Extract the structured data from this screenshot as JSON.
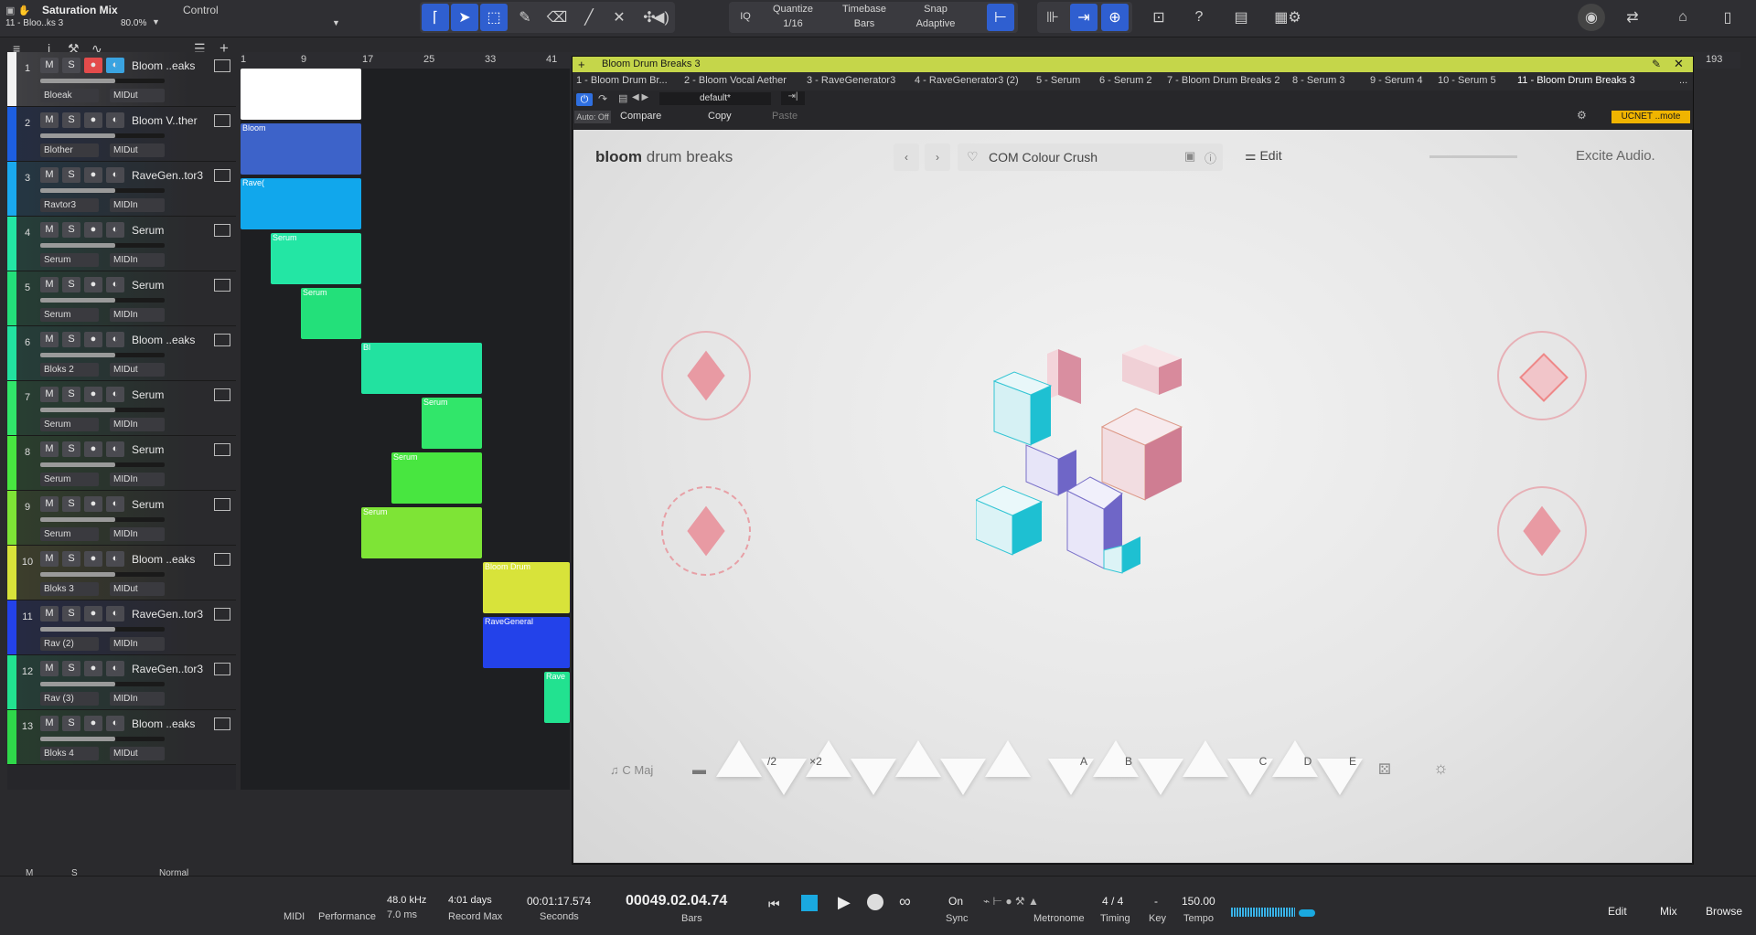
{
  "app": {
    "song_title": "Saturation Mix",
    "selected_track": "11 - Bloo..ks 3",
    "zoom": "80.0%",
    "control_label": "Control"
  },
  "toolbar": {
    "iq": "IQ",
    "quantize_label": "Quantize",
    "quantize_value": "1/16",
    "timebase_label": "Timebase",
    "timebase_value": "Bars",
    "snap_label": "Snap",
    "snap_value": "Adaptive"
  },
  "ruler": {
    "ticks": [
      "1",
      "9",
      "17",
      "25",
      "33",
      "41",
      "",
      "",
      "",
      "",
      "",
      "",
      "",
      "",
      "",
      "",
      "",
      "",
      "",
      "",
      "193"
    ]
  },
  "tracks": [
    {
      "num": "1",
      "name": "Bloom ..eaks",
      "insert": "Bloeak",
      "input": "MIDut",
      "color": "#f2f2f2",
      "rec": true
    },
    {
      "num": "2",
      "name": "Bloom V..ther",
      "insert": "Blother",
      "input": "MIDut",
      "color": "#1d5fe0",
      "rec": false
    },
    {
      "num": "3",
      "name": "RaveGen..tor3",
      "insert": "Ravtor3",
      "input": "MIDIn",
      "color": "#1aa8ee",
      "rec": false
    },
    {
      "num": "4",
      "name": "Serum",
      "insert": "Serum",
      "input": "MIDIn",
      "color": "#23e6a4",
      "rec": false
    },
    {
      "num": "5",
      "name": "Serum",
      "insert": "Serum",
      "input": "MIDIn",
      "color": "#23e07a",
      "rec": false
    },
    {
      "num": "6",
      "name": "Bloom ..eaks",
      "insert": "Bloks 2",
      "input": "MIDut",
      "color": "#22e2a0",
      "rec": false
    },
    {
      "num": "7",
      "name": "Serum",
      "insert": "Serum",
      "input": "MIDIn",
      "color": "#31e66a",
      "rec": false
    },
    {
      "num": "8",
      "name": "Serum",
      "insert": "Serum",
      "input": "MIDIn",
      "color": "#48e640",
      "rec": false
    },
    {
      "num": "9",
      "name": "Serum",
      "insert": "Serum",
      "input": "MIDIn",
      "color": "#7ee436",
      "rec": false
    },
    {
      "num": "10",
      "name": "Bloom ..eaks",
      "insert": "Bloks 3",
      "input": "MIDut",
      "color": "#d8e33a",
      "rec": false
    },
    {
      "num": "11",
      "name": "RaveGen..tor3",
      "insert": "Rav (2)",
      "input": "MIDIn",
      "color": "#2342ea",
      "rec": false
    },
    {
      "num": "12",
      "name": "RaveGen..tor3",
      "insert": "Rav (3)",
      "input": "MIDIn",
      "color": "#22e290",
      "rec": false
    },
    {
      "num": "13",
      "name": "Bloom ..eaks",
      "insert": "Bloks 4",
      "input": "MIDut",
      "color": "#2fd84a",
      "rec": false
    }
  ],
  "track_buttons": {
    "mute": "M",
    "solo": "S"
  },
  "clips": {
    "bloom_short": "Bl",
    "bloom": "Bloom",
    "bloom_drum": "Bloom Drum",
    "rave": "Rave(",
    "rave_long": "RaveGeneral",
    "serum": "Serum",
    "rave_short": "Rave"
  },
  "plugin": {
    "title": "Bloom Drum Breaks 3",
    "tabs": [
      "1 - Bloom Drum Br...",
      "2 - Bloom Vocal Aether",
      "3 - RaveGenerator3",
      "4 - RaveGenerator3 (2)",
      "5 - Serum",
      "6 - Serum 2",
      "7 - Bloom Drum Breaks 2",
      "8 - Serum 3",
      "9 - Serum 4",
      "10 - Serum 5",
      "11 - Bloom Drum Breaks 3"
    ],
    "more": "...",
    "preset": "default*",
    "auto": "Auto: Off",
    "compare": "Compare",
    "copy": "Copy",
    "paste": "Paste",
    "remote_badge": "UCNET ..mote",
    "brand_bold": "bloom",
    "brand_light": "drum breaks",
    "preset_name": "COM Colour Crush",
    "edit": "Edit",
    "vendor": "Excite Audio.",
    "key": "C Maj",
    "pads": [
      "/2",
      "×2",
      "",
      "",
      "",
      "A",
      "B",
      "",
      "C",
      "D",
      "E"
    ]
  },
  "bottom": {
    "midi": "MIDI",
    "performance": "Performance",
    "sample_rate": "48.0 kHz",
    "latency": "7.0 ms",
    "record_days": "4:01 days",
    "record_max": "Record Max",
    "time_seconds": "00:01:17.574",
    "seconds_label": "Seconds",
    "position": "00049.02.04.74",
    "bars_label": "Bars",
    "sync_on": "On",
    "sync": "Sync",
    "metronome": "Metronome",
    "signature": "4 / 4",
    "timing": "Timing",
    "key_value": "-",
    "key": "Key",
    "tempo_value": "150.00",
    "tempo": "Tempo",
    "edit": "Edit",
    "mix": "Mix",
    "browse": "Browse",
    "left_m": "M",
    "left_s": "S",
    "mode": "Normal"
  }
}
